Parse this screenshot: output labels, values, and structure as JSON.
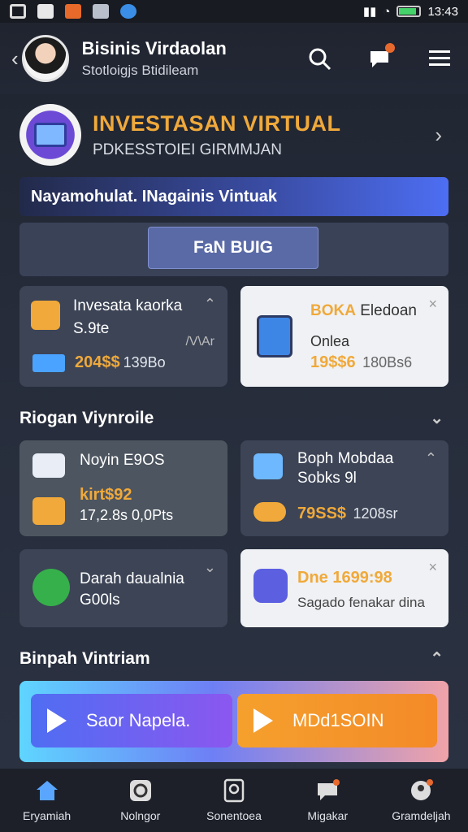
{
  "status": {
    "time": "13:43"
  },
  "header": {
    "title": "Bisinis Virdaolan",
    "subtitle": "Stotloigjs Btidileam"
  },
  "hero": {
    "title": "INVESTASAN VIRTUAL",
    "subtitle": "PDKESSTOIEI GIRMMJAN"
  },
  "banner": {
    "text": "Nayamohulat. INagainis Vintuak"
  },
  "fund_button": {
    "label": "FaN BUIG"
  },
  "cards_top": [
    {
      "title": "Invesata kaorka",
      "subtitle": "S.9te",
      "extra": "/V\\Ar",
      "value": "204$$",
      "value2": "139Bo"
    },
    {
      "title_highlight": "BOKA",
      "title": "Eledoan",
      "subtitle": "Onlea",
      "value": "19$$6",
      "value2": "180Bs6"
    }
  ],
  "section1": {
    "title": "Riogan Viynroile"
  },
  "cards_mid": [
    {
      "title": "Noyin E9OS",
      "value": "kirt$92",
      "value2": "17,2.8s 0,0Pts"
    },
    {
      "title": "Boph Mobdaa",
      "subtitle": "Sobks 9l",
      "value": "79SS$",
      "value2": "1208sr"
    }
  ],
  "cards_low": [
    {
      "title": "Darah daualnia",
      "subtitle": "G00ls"
    },
    {
      "value": "Dne 1699:98",
      "subtitle": "Sagado fenakar dina"
    }
  ],
  "section2": {
    "title": "Binpah Vintriam"
  },
  "play_buttons": [
    {
      "label": "Saor Napela."
    },
    {
      "label": "MDd1SOIN"
    }
  ],
  "nav": [
    {
      "label": "Eryamiah",
      "icon": "home-icon"
    },
    {
      "label": "Nolngor",
      "icon": "refresh-icon"
    },
    {
      "label": "Sonentoea",
      "icon": "search-doc-icon"
    },
    {
      "label": "Migakar",
      "icon": "chat-icon"
    },
    {
      "label": "Gramdeljah",
      "icon": "profile-icon"
    }
  ],
  "colors": {
    "accent_orange": "#f0a93a",
    "accent_blue": "#4d6ef3"
  }
}
